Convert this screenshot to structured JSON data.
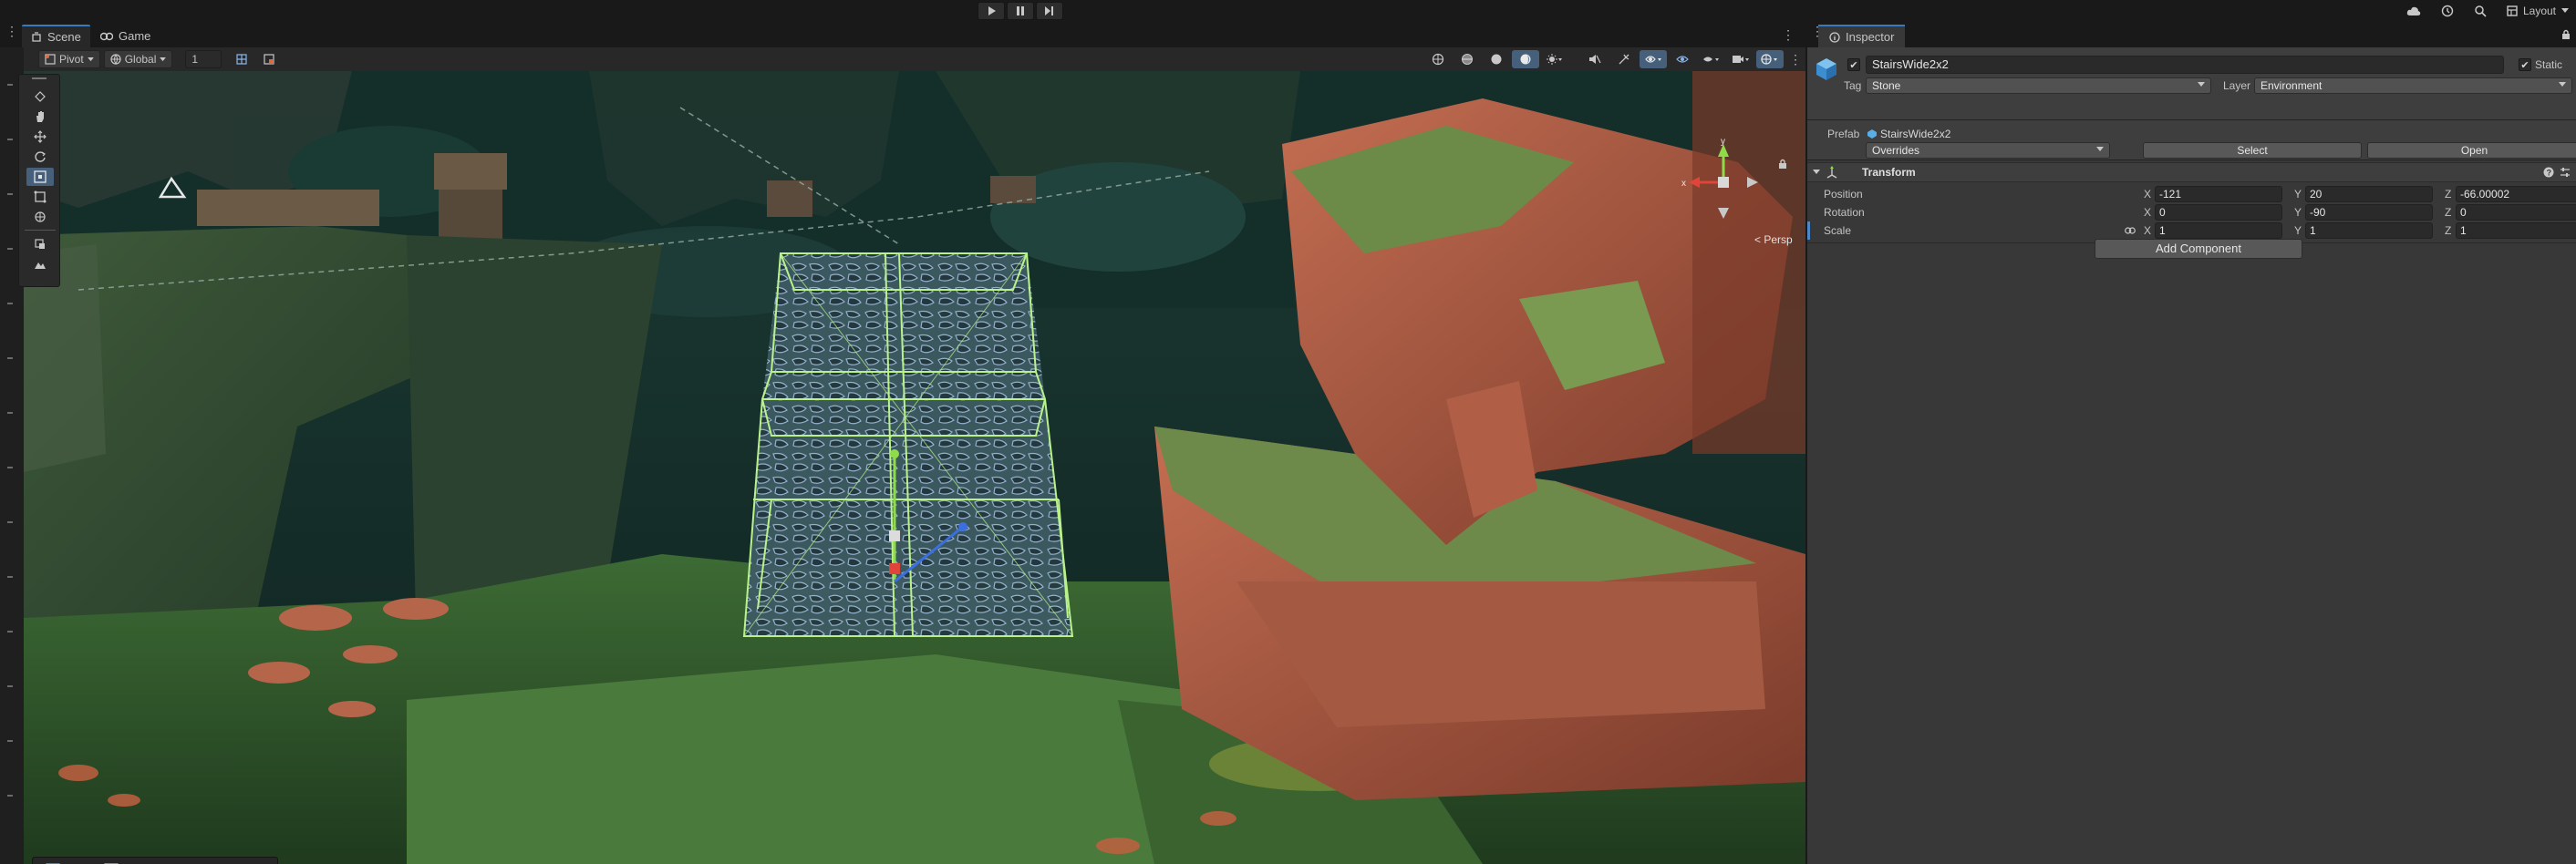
{
  "toolbar": {
    "play_icon": "play-icon",
    "pause_icon": "pause-icon",
    "step_icon": "step-icon",
    "layout_label": "Layout"
  },
  "scene": {
    "tabs": [
      {
        "label": "Scene",
        "icon": "scene-icon",
        "active": true
      },
      {
        "label": "Game",
        "icon": "game-icon",
        "active": false
      }
    ],
    "pivot_label": "Pivot",
    "global_label": "Global",
    "grid_snap_value": "1",
    "persp_label": "Persp",
    "gizmo_axes": {
      "x": "x",
      "y": "y"
    }
  },
  "inspector": {
    "tab_label": "Inspector",
    "object": {
      "active": true,
      "name": "StairsWide2x2",
      "static_label": "Static",
      "static": true,
      "tag_label": "Tag",
      "tag_value": "Stone",
      "layer_label": "Layer",
      "layer_value": "Environment"
    },
    "prefab": {
      "label": "Prefab",
      "name": "StairsWide2x2",
      "overrides_label": "Overrides",
      "select_label": "Select",
      "open_label": "Open"
    },
    "transform": {
      "title": "Transform",
      "rows": [
        {
          "label": "Position",
          "x": "-121",
          "y": "20",
          "z": "-66.00002"
        },
        {
          "label": "Rotation",
          "x": "0",
          "y": "-90",
          "z": "0"
        },
        {
          "label": "Scale",
          "x": "1",
          "y": "1",
          "z": "1"
        }
      ],
      "axis_labels": {
        "x": "X",
        "y": "Y",
        "z": "Z"
      }
    },
    "add_component_label": "Add Component"
  },
  "colors": {
    "accent": "#3a79bb",
    "selection_outline": "#b9f28a",
    "gizmo_x": "#e0443a",
    "gizmo_y": "#8fdc4a",
    "gizmo_z": "#3b6fe0"
  }
}
